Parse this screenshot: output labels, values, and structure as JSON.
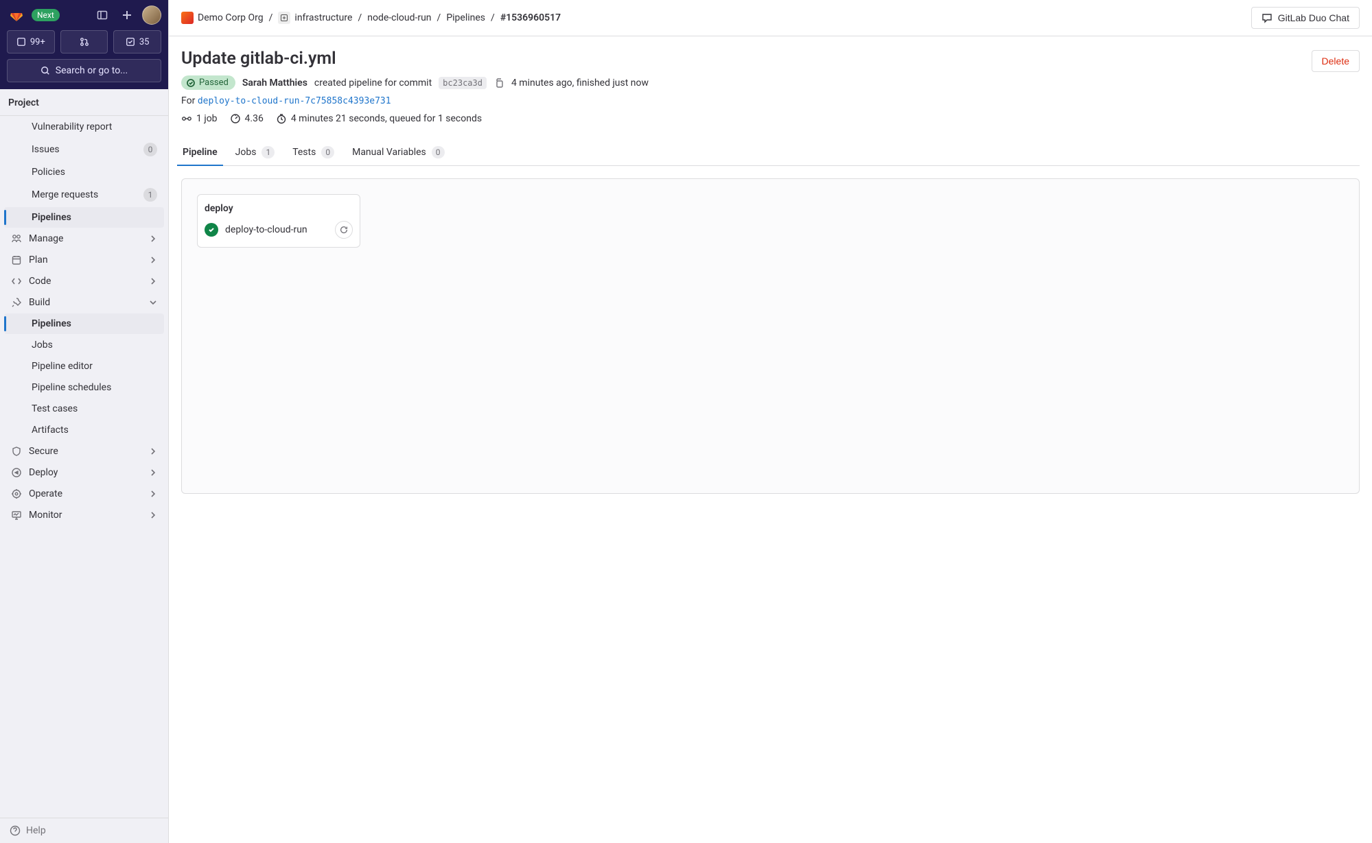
{
  "header": {
    "next_label": "Next",
    "counters": {
      "issues": "99+",
      "mrs": "",
      "todos": "35"
    },
    "search_label": "Search or go to..."
  },
  "sidebar": {
    "section": "Project",
    "items_top": [
      {
        "label": "Vulnerability report"
      },
      {
        "label": "Issues",
        "badge": "0"
      },
      {
        "label": "Policies"
      },
      {
        "label": "Merge requests",
        "badge": "1"
      },
      {
        "label": "Pipelines",
        "active": true
      }
    ],
    "groups": [
      {
        "label": "Manage"
      },
      {
        "label": "Plan"
      },
      {
        "label": "Code"
      },
      {
        "label": "Build",
        "expanded": true,
        "children": [
          {
            "label": "Pipelines",
            "active": true
          },
          {
            "label": "Jobs"
          },
          {
            "label": "Pipeline editor"
          },
          {
            "label": "Pipeline schedules"
          },
          {
            "label": "Test cases"
          },
          {
            "label": "Artifacts"
          }
        ]
      },
      {
        "label": "Secure"
      },
      {
        "label": "Deploy"
      },
      {
        "label": "Operate"
      },
      {
        "label": "Monitor"
      }
    ],
    "help": "Help"
  },
  "breadcrumbs": {
    "org": "Demo Corp Org",
    "group": "infrastructure",
    "project": "node-cloud-run",
    "section": "Pipelines",
    "id": "#1536960517"
  },
  "topbar": {
    "chat_button": "GitLab Duo Chat"
  },
  "page": {
    "title": "Update gitlab-ci.yml",
    "delete_button": "Delete",
    "status": "Passed",
    "author": "Sarah Matthies",
    "created_text": "created pipeline for commit",
    "commit_sha": "bc23ca3d",
    "time_text": "4 minutes ago, finished just now",
    "for_label": "For",
    "branch": "deploy-to-cloud-run-7c75858c4393e731",
    "stats": {
      "jobs": "1 job",
      "score": "4.36",
      "duration": "4 minutes 21 seconds, queued for 1 seconds"
    }
  },
  "tabs": [
    {
      "label": "Pipeline",
      "active": true
    },
    {
      "label": "Jobs",
      "badge": "1"
    },
    {
      "label": "Tests",
      "badge": "0"
    },
    {
      "label": "Manual Variables",
      "badge": "0"
    }
  ],
  "stage": {
    "name": "deploy",
    "job": "deploy-to-cloud-run"
  }
}
